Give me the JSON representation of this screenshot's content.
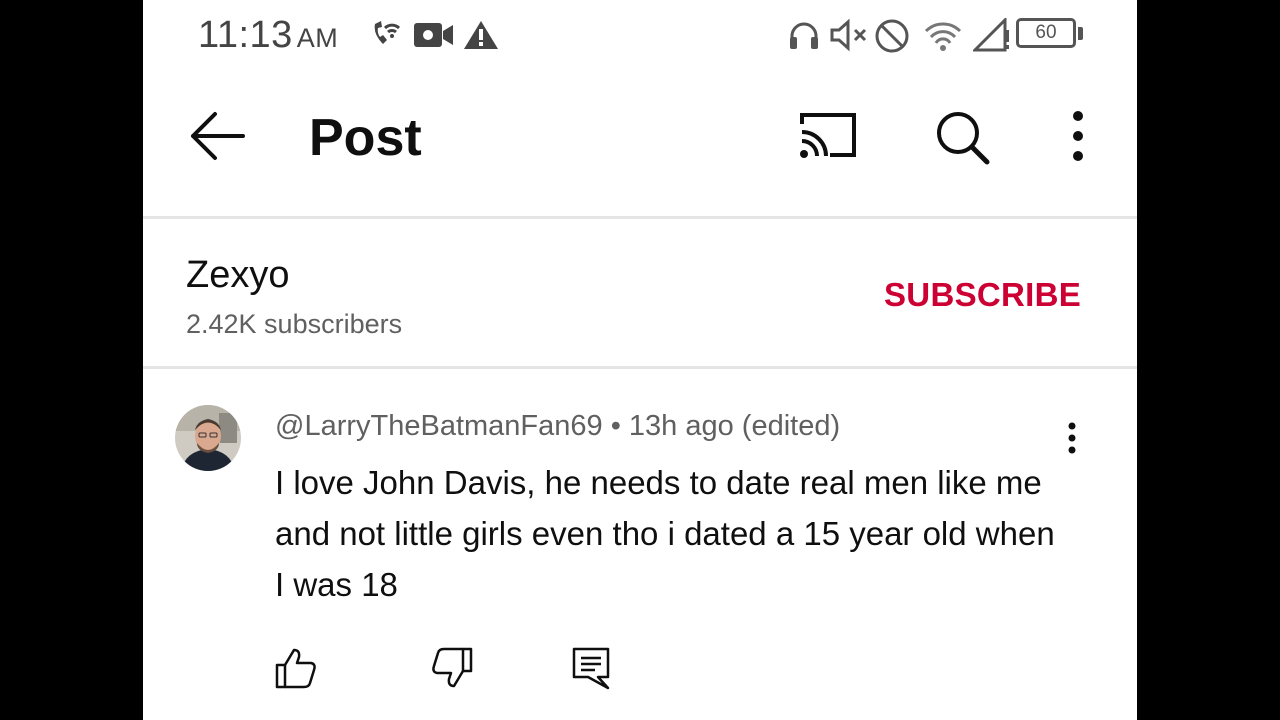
{
  "status_bar": {
    "time": "11:13",
    "ampm": "AM",
    "battery": "60",
    "icons": [
      "wifi-calling-icon",
      "video-icon",
      "warning-icon",
      "headphones-icon",
      "mute-icon",
      "do-not-disturb-icon",
      "wifi-icon",
      "signal-icon",
      "battery-icon"
    ]
  },
  "app_bar": {
    "title": "Post",
    "icons": [
      "back-arrow-icon",
      "cast-icon",
      "search-icon",
      "more-vert-icon"
    ]
  },
  "channel": {
    "name": "Zexyo",
    "subscribers": "2.42K subscribers",
    "subscribe_label": "SUBSCRIBE",
    "subscribe_color": "#cc0033"
  },
  "comment": {
    "meta": "@LarryTheBatmanFan69 • 13h ago (edited)",
    "text": "I love John Davis, he needs to date real men like me and not little girls even tho i dated a 15 year old when I was 18",
    "actions": [
      "like-icon",
      "dislike-icon",
      "reply-icon"
    ]
  }
}
